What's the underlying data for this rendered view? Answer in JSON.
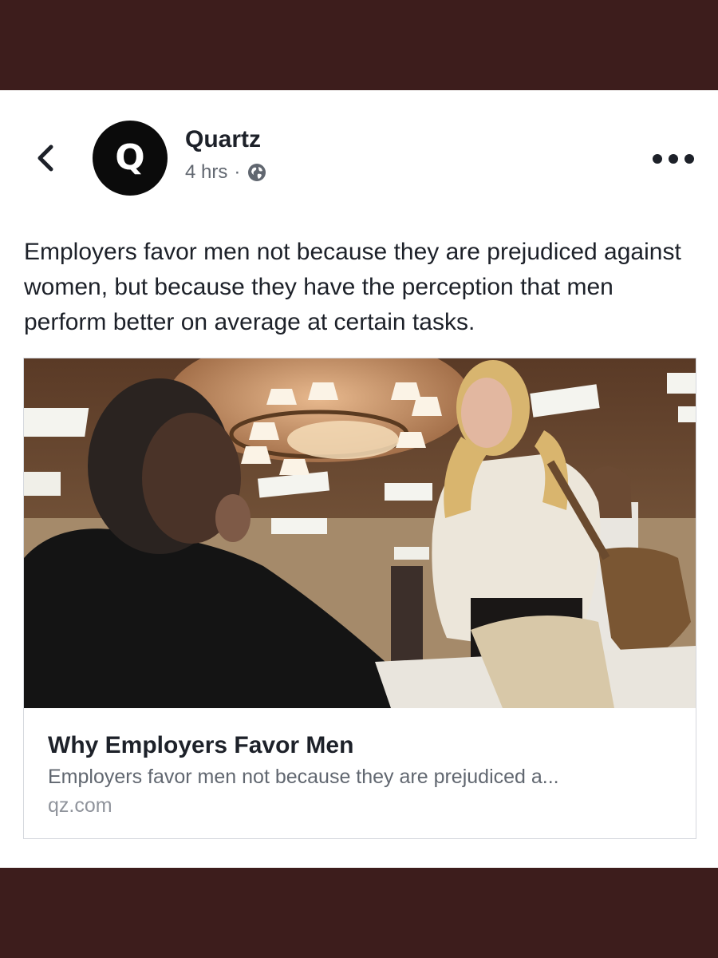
{
  "post": {
    "page_name": "Quartz",
    "avatar_letter": "Q",
    "timestamp": "4 hrs",
    "separator": "·",
    "text": "Employers favor men not because they are prejudiced against women, but because they have the perception that men perform better on average at certain tasks."
  },
  "link_preview": {
    "title": "Why Employers Favor Men",
    "description": "Employers favor men not because they are prejudiced a...",
    "domain": "qz.com"
  },
  "icons": {
    "back": "chevron-left-icon",
    "more": "more-options-icon",
    "privacy": "globe-icon"
  },
  "colors": {
    "frame_band": "#3d1d1c",
    "card_bg": "#ffffff",
    "text_primary": "#1d2129",
    "text_secondary": "#616770",
    "text_muted": "#90949c",
    "avatar_bg": "#0b0b0b"
  }
}
